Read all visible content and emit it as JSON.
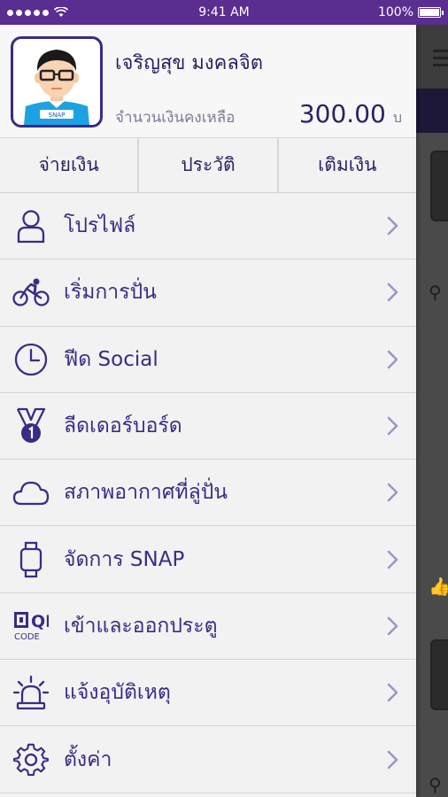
{
  "status_bar": {
    "time": "9:41 AM",
    "battery": "100%"
  },
  "profile": {
    "name": "เจริญสุข มงคลจิต",
    "balance_label": "จำนวนเงินคงเหลือ",
    "balance_amount": "300.00",
    "balance_unit": "บ",
    "avatar_badge": "SNAP"
  },
  "actions": [
    {
      "label": "จ่ายเงิน"
    },
    {
      "label": "ประวัติ"
    },
    {
      "label": "เติมเงิน"
    }
  ],
  "menu": [
    {
      "label": "โปรไฟล์",
      "icon": "person-icon"
    },
    {
      "label": "เริ่มการปั่น",
      "icon": "bicycle-icon"
    },
    {
      "label": "ฟีด Social",
      "icon": "clock-icon"
    },
    {
      "label": "ลีดเดอร์บอร์ด",
      "icon": "medal-icon"
    },
    {
      "label": "สภาพอากาศที่ลู่ปั่น",
      "icon": "cloud-icon"
    },
    {
      "label": "จัดการ SNAP",
      "icon": "watch-icon"
    },
    {
      "label": "เข้าและออกประตู",
      "icon": "qr-code-icon"
    },
    {
      "label": "แจ้งอุบัติเหตุ",
      "icon": "siren-icon"
    },
    {
      "label": "ตั้งค่า",
      "icon": "gear-icon"
    }
  ],
  "qr_icon_text": {
    "top": "QR",
    "bottom": "CODE"
  },
  "colors": {
    "accent": "#3a2b86",
    "status_bar": "#5a2d91",
    "chevron": "#9c96c8"
  }
}
